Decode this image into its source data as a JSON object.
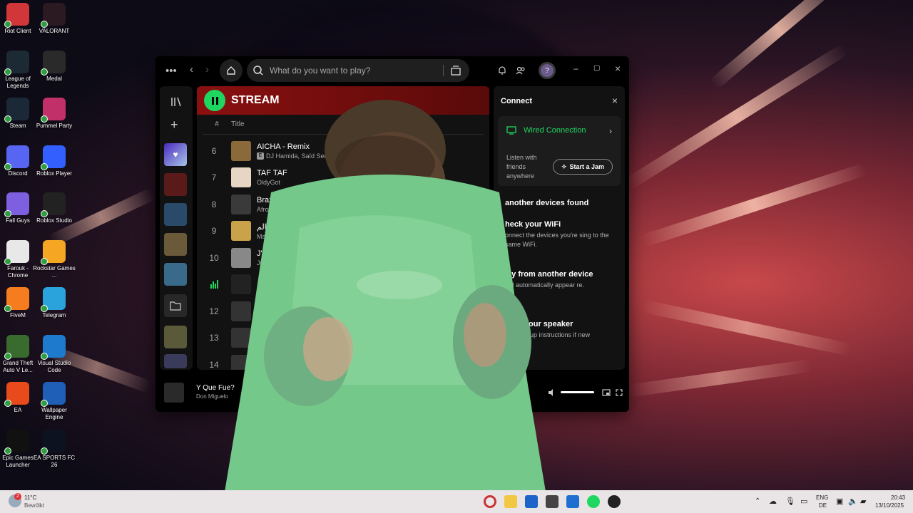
{
  "desktop": {
    "icons": [
      {
        "label": "Riot Client",
        "icon": "riot-client-icon",
        "color": "#d13639"
      },
      {
        "label": "VALORANT",
        "icon": "valorant-icon",
        "color": "#2b1a22"
      },
      {
        "label": "League of Legends",
        "icon": "league-icon",
        "color": "#1c2a34"
      },
      {
        "label": "Medal",
        "icon": "medal-icon",
        "color": "#2a2a2a"
      },
      {
        "label": "Steam",
        "icon": "steam-icon",
        "color": "#1b2838"
      },
      {
        "label": "Pummel Party",
        "icon": "pummel-party-icon",
        "color": "#c2306a"
      },
      {
        "label": "Discord",
        "icon": "discord-icon",
        "color": "#5865f2"
      },
      {
        "label": "Roblox Player",
        "icon": "roblox-icon",
        "color": "#335fff"
      },
      {
        "label": "Fall Guys",
        "icon": "fall-guys-icon",
        "color": "#7d5fe0"
      },
      {
        "label": "Roblox Studio",
        "icon": "roblox-studio-icon",
        "color": "#222"
      },
      {
        "label": "Farouk - Chrome",
        "icon": "chrome-icon",
        "color": "#e8e8e8"
      },
      {
        "label": "Rockstar Games ...",
        "icon": "rockstar-icon",
        "color": "#f5a623"
      },
      {
        "label": "FiveM",
        "icon": "fivem-icon",
        "color": "#f57c1f"
      },
      {
        "label": "Telegram",
        "icon": "telegram-icon",
        "color": "#2aa3dd"
      },
      {
        "label": "Grand Theft Auto V Le...",
        "icon": "gta-icon",
        "color": "#3a6b2e"
      },
      {
        "label": "Visual Studio Code",
        "icon": "vscode-icon",
        "color": "#1e7acc"
      },
      {
        "label": "EA",
        "icon": "ea-icon",
        "color": "#e84a1c"
      },
      {
        "label": "Wallpaper Engine",
        "icon": "wallpaper-engine-icon",
        "color": "#1f5fb8"
      },
      {
        "label": "Epic Games Launcher",
        "icon": "epic-games-icon",
        "color": "#111"
      },
      {
        "label": "EA SPORTS FC 26",
        "icon": "fc26-icon",
        "color": "#0d1220"
      }
    ]
  },
  "spotify": {
    "search_placeholder": "What do you want to play?",
    "playlist_title": "STREAM",
    "column_title": "Title",
    "tracks": [
      {
        "num": "6",
        "title": "AICHA - Remix",
        "artist": "DJ Hamida, Saïd Senh",
        "explicit": true,
        "cover": "#8a6a3a"
      },
      {
        "num": "7",
        "title": "TAF TAF",
        "artist": "OldyGot",
        "explicit": false,
        "cover": "#e8d6c4"
      },
      {
        "num": "8",
        "title": "Brazil",
        "artist": "Afrot",
        "explicit": false,
        "cover": "#3a3a3a"
      },
      {
        "num": "9",
        "title": "عالم",
        "artist": "Mar",
        "explicit": false,
        "cover": "#caa24a"
      },
      {
        "num": "10",
        "title": "J'o",
        "artist": "Ju",
        "explicit": false,
        "cover": "#888"
      },
      {
        "num": "",
        "title": "",
        "artist": "",
        "explicit": false,
        "cover": "#222"
      },
      {
        "num": "12",
        "title": "",
        "artist": "",
        "explicit": false,
        "cover": "#333"
      },
      {
        "num": "13",
        "title": "",
        "artist": "",
        "explicit": false,
        "cover": "#333"
      },
      {
        "num": "14",
        "title": "",
        "artist": "",
        "explicit": false,
        "cover": "#333"
      }
    ],
    "connect": {
      "title": "Connect",
      "wired": "Wired Connection",
      "listen_text": "Listen with friends anywhere",
      "jam_button": "Start a Jam",
      "no_devices": "another devices found",
      "tips": [
        {
          "heading": "heck your WiFi",
          "desc": "onnect the devices you're sing to the same WiFi."
        },
        {
          "heading": "lay from another device",
          "desc": "will automatically appear re."
        },
        {
          "heading": "start your speaker",
          "desc": "ollow setup instructions if new device."
        }
      ]
    },
    "now_playing": {
      "title": "Y Que Fue?",
      "artist": "Don Miguelo",
      "time": "43"
    }
  },
  "taskbar": {
    "weather_temp": "11°C",
    "weather_desc": "Bewölkt",
    "weather_badge": "2",
    "lang_top": "ENG",
    "lang_bottom": "DE",
    "time": "20:43",
    "date": "13/10/2025"
  },
  "colors": {
    "spotify_green": "#1ed760",
    "playlist_red": "#8a1010"
  }
}
